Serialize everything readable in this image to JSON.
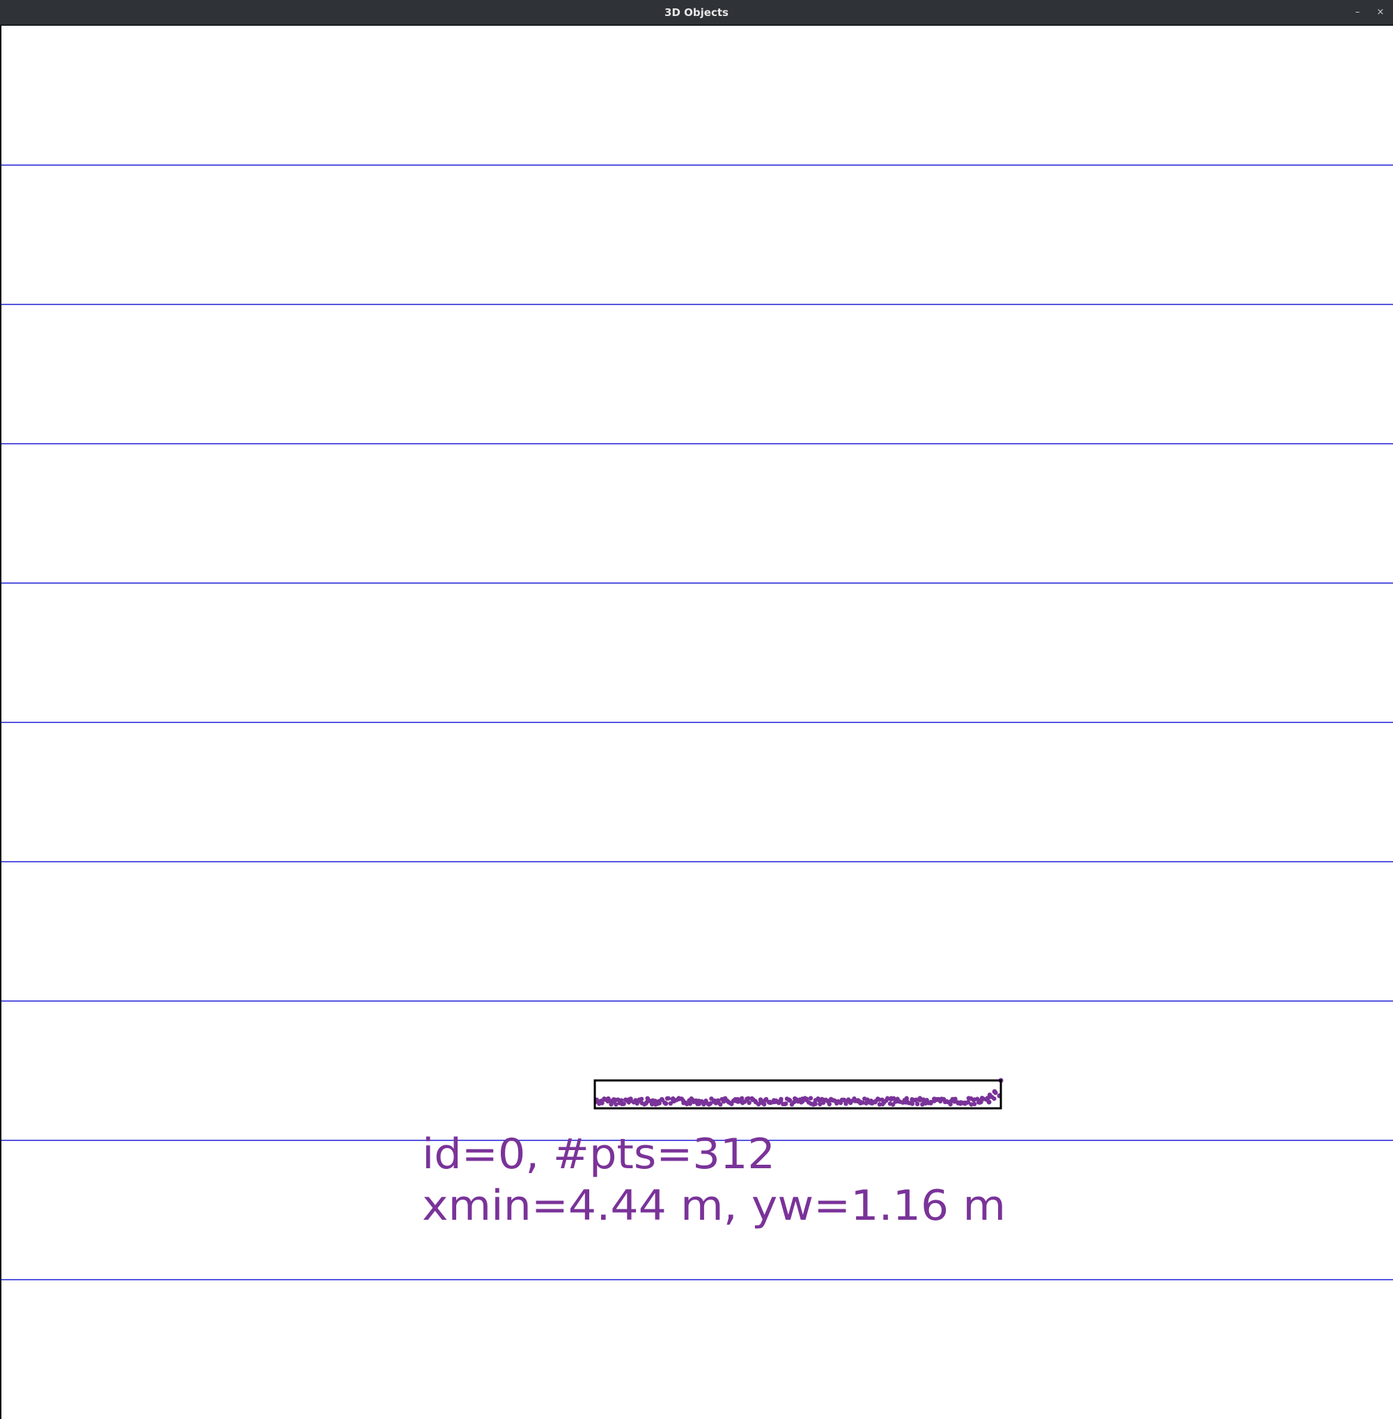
{
  "window": {
    "title": "3D Objects",
    "minimize_icon": "minimize-icon",
    "close_icon": "close-icon",
    "minimize_glyph": "–",
    "close_glyph": "×"
  },
  "view": {
    "grid_color": "#1f1fd6",
    "object_color": "#7a3399",
    "box_color": "#000000"
  },
  "objects": [
    {
      "id": 0,
      "label_line1": "id=0, #pts=312",
      "label_line2": "xmin=4.44 m, yw=1.16 m"
    }
  ]
}
